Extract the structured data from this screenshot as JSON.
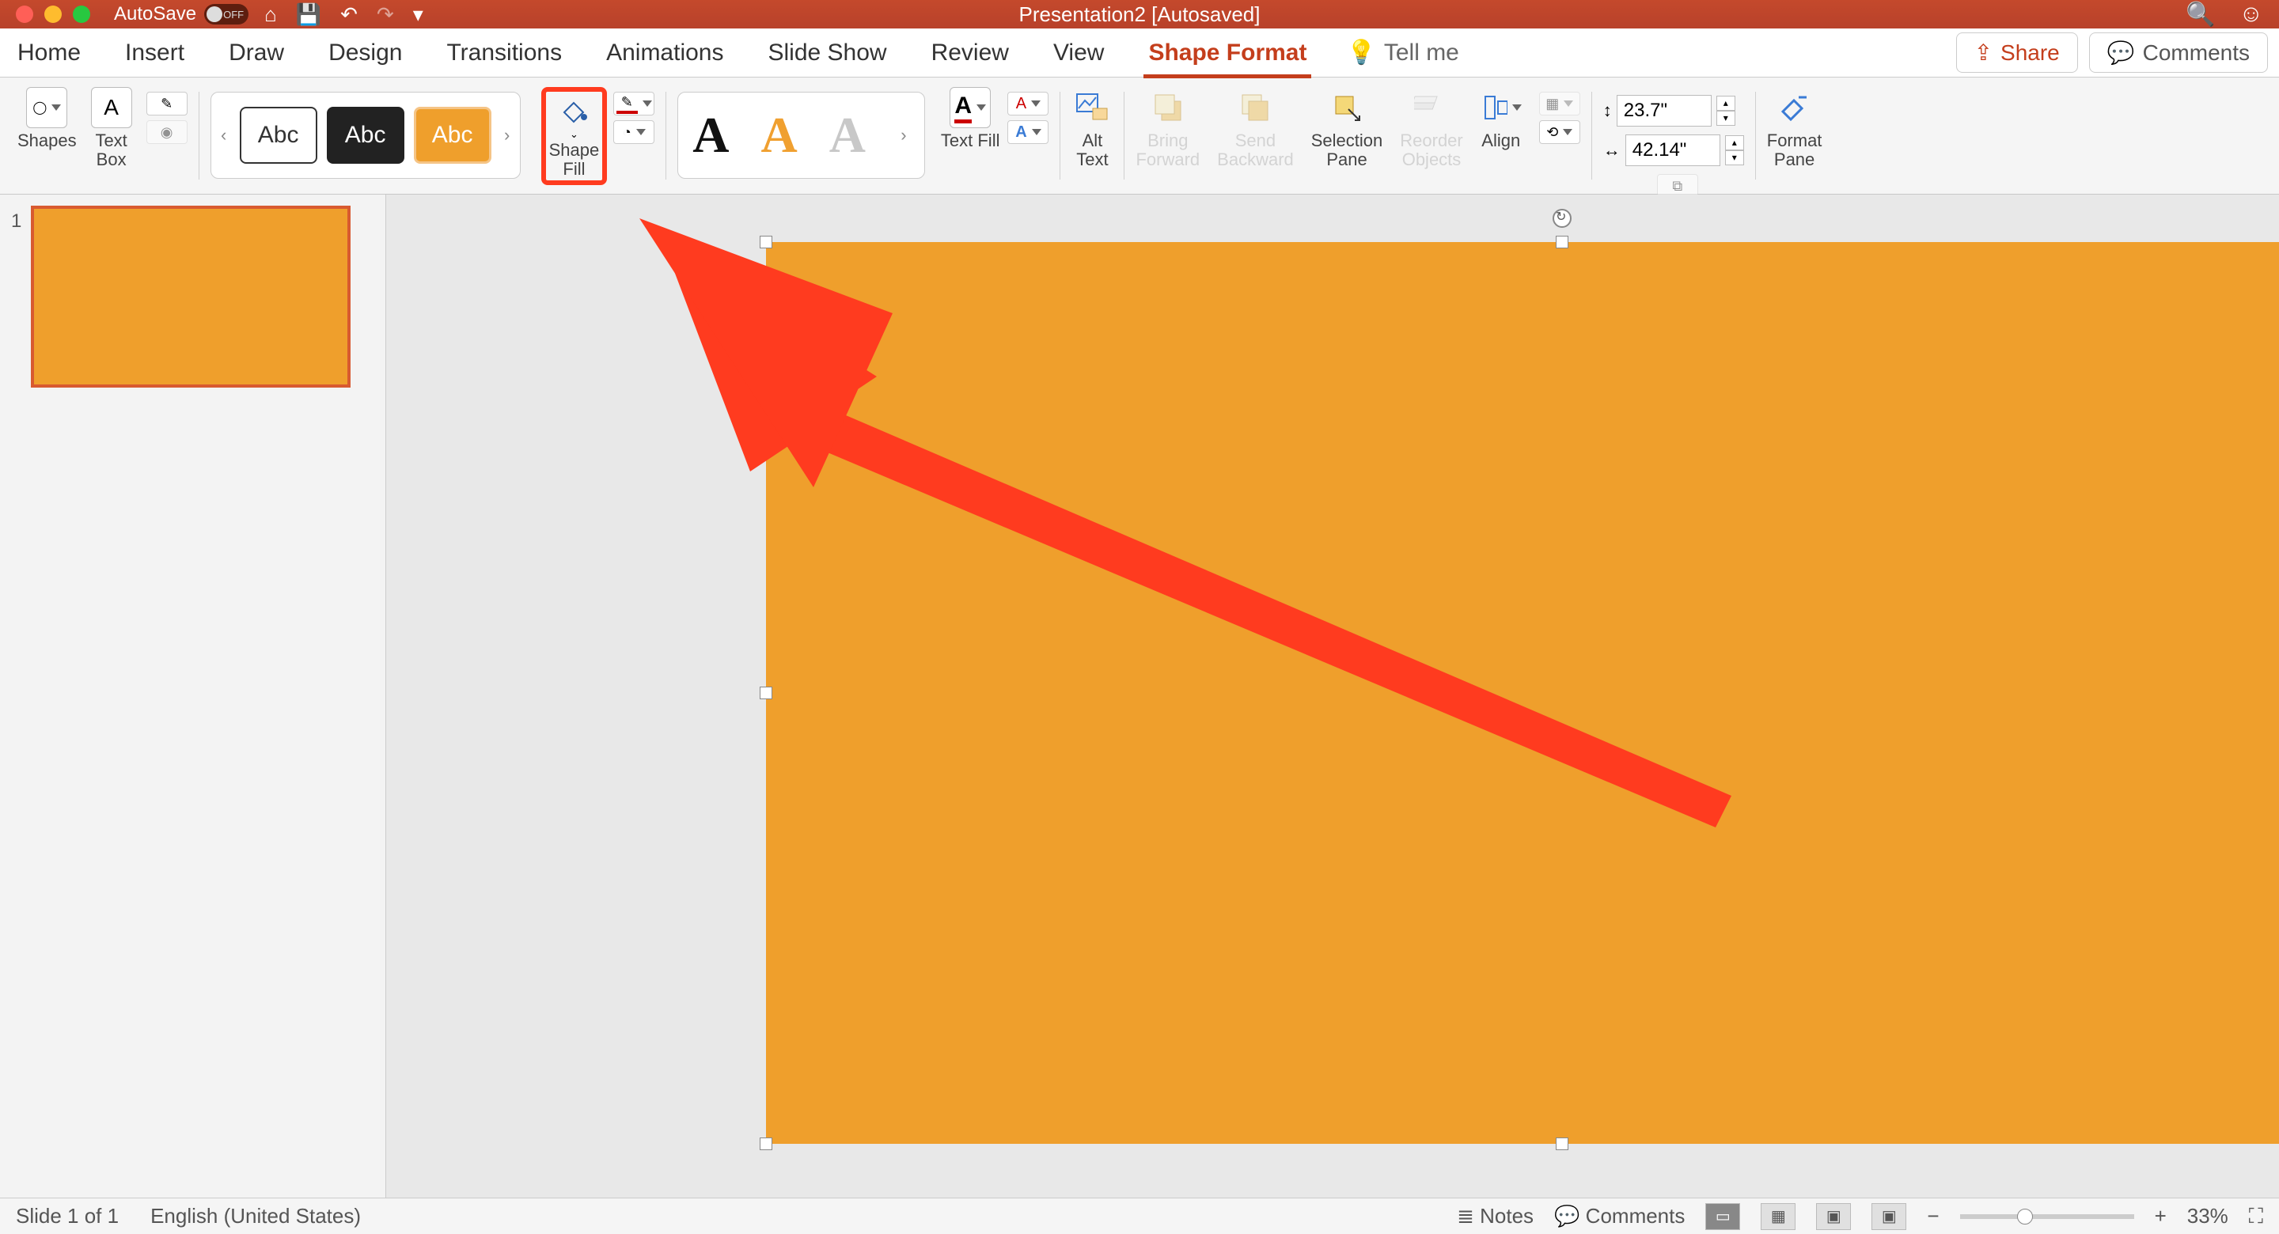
{
  "titlebar": {
    "autosave_label": "AutoSave",
    "autosave_state": "OFF",
    "doc_title": "Presentation2 [Autosaved]"
  },
  "tabs": {
    "home": "Home",
    "insert": "Insert",
    "draw": "Draw",
    "design": "Design",
    "transitions": "Transitions",
    "animations": "Animations",
    "slideshow": "Slide Show",
    "review": "Review",
    "view": "View",
    "shape_format": "Shape Format",
    "tellme": "Tell me"
  },
  "rightbtns": {
    "share": "Share",
    "comments": "Comments"
  },
  "ribbon": {
    "shapes": "Shapes",
    "textbox": "Text\nBox",
    "style_labels": [
      "Abc",
      "Abc",
      "Abc"
    ],
    "shape_fill": "Shape\nFill",
    "text_fill": "Text Fill",
    "alt_text": "Alt\nText",
    "bring_forward": "Bring\nForward",
    "send_backward": "Send\nBackward",
    "selection_pane": "Selection\nPane",
    "reorder": "Reorder\nObjects",
    "align": "Align",
    "height": "23.7\"",
    "width": "42.14\"",
    "format_pane": "Format\nPane"
  },
  "thumb": {
    "num": "1"
  },
  "status": {
    "slide": "Slide 1 of 1",
    "lang": "English (United States)",
    "notes": "Notes",
    "comments": "Comments",
    "zoom": "33%"
  }
}
